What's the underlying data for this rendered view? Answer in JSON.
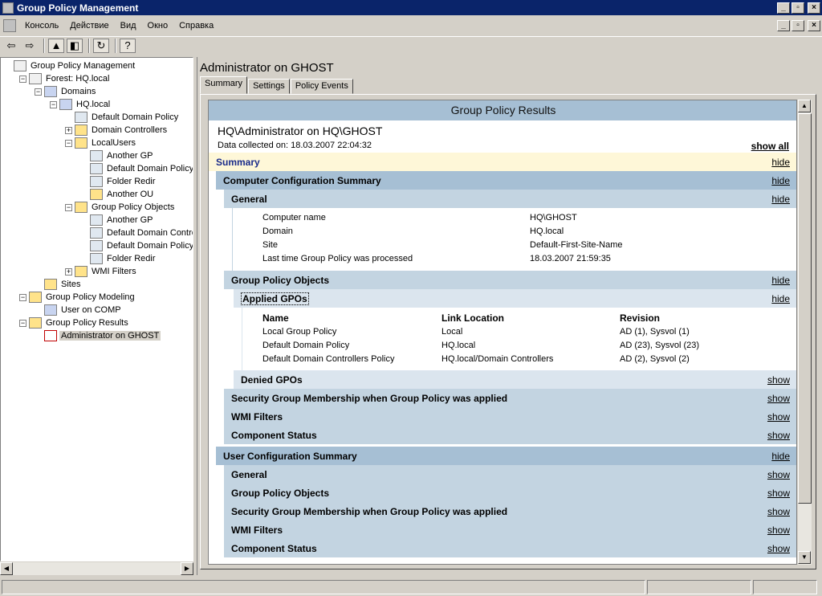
{
  "window": {
    "title": "Group Policy Management"
  },
  "menu": [
    "Консоль",
    "Действие",
    "Вид",
    "Окно",
    "Справка"
  ],
  "tree": [
    {
      "label": "Group Policy Management",
      "level": 0,
      "icon": "gpmc-icon",
      "expander": ""
    },
    {
      "label": "Forest: HQ.local",
      "level": 1,
      "icon": "forest-icon",
      "expander": "−"
    },
    {
      "label": "Domains",
      "level": 2,
      "icon": "domains-icon",
      "expander": "−"
    },
    {
      "label": "HQ.local",
      "level": 3,
      "icon": "domain-icon",
      "expander": "−"
    },
    {
      "label": "Default Domain Policy",
      "level": 4,
      "icon": "gpo-link-icon",
      "expander": ""
    },
    {
      "label": "Domain Controllers",
      "level": 4,
      "icon": "ou-icon",
      "expander": "+"
    },
    {
      "label": "LocalUsers",
      "level": 4,
      "icon": "ou-icon",
      "expander": "−"
    },
    {
      "label": "Another GP",
      "level": 5,
      "icon": "gpo-link-icon",
      "expander": ""
    },
    {
      "label": "Default Domain Policy",
      "level": 5,
      "icon": "gpo-link-icon",
      "expander": ""
    },
    {
      "label": "Folder Redir",
      "level": 5,
      "icon": "gpo-link-icon",
      "expander": ""
    },
    {
      "label": "Another OU",
      "level": 5,
      "icon": "ou-icon",
      "expander": ""
    },
    {
      "label": "Group Policy Objects",
      "level": 4,
      "icon": "gpo-folder-icon",
      "expander": "−"
    },
    {
      "label": "Another GP",
      "level": 5,
      "icon": "gpo-icon",
      "expander": ""
    },
    {
      "label": "Default Domain Controller",
      "level": 5,
      "icon": "gpo-icon",
      "expander": ""
    },
    {
      "label": "Default Domain Policy",
      "level": 5,
      "icon": "gpo-icon",
      "expander": ""
    },
    {
      "label": "Folder Redir",
      "level": 5,
      "icon": "gpo-icon",
      "expander": ""
    },
    {
      "label": "WMI Filters",
      "level": 4,
      "icon": "wmi-folder-icon",
      "expander": "+"
    },
    {
      "label": "Sites",
      "level": 2,
      "icon": "sites-icon",
      "expander": ""
    },
    {
      "label": "Group Policy Modeling",
      "level": 1,
      "icon": "modeling-icon",
      "expander": "−"
    },
    {
      "label": "User on COMP",
      "level": 2,
      "icon": "modeling-result-icon",
      "expander": ""
    },
    {
      "label": "Group Policy Results",
      "level": 1,
      "icon": "results-icon",
      "expander": "−"
    },
    {
      "label": "Administrator on GHOST",
      "level": 2,
      "icon": "result-report-icon",
      "expander": "",
      "selected": true
    }
  ],
  "main": {
    "title": "Administrator on GHOST",
    "tabs": [
      "Summary",
      "Settings",
      "Policy Events"
    ]
  },
  "report": {
    "header": "Group Policy Results",
    "subtitle": "HQ\\Administrator on HQ\\GHOST",
    "collected": "Data collected on: 18.03.2007 22:04:32",
    "show_all": "show all",
    "summary": {
      "label": "Summary",
      "action": "hide"
    },
    "computer": {
      "label": "Computer Configuration Summary",
      "action": "hide",
      "general": {
        "label": "General",
        "action": "hide",
        "rows": [
          {
            "k": "Computer name",
            "v": "HQ\\GHOST"
          },
          {
            "k": "Domain",
            "v": "HQ.local"
          },
          {
            "k": "Site",
            "v": "Default-First-Site-Name"
          },
          {
            "k": "Last time Group Policy was processed",
            "v": "18.03.2007 21:59:35"
          }
        ]
      },
      "gpo": {
        "label": "Group Policy Objects",
        "action": "hide",
        "applied": {
          "label": "Applied GPOs",
          "action": "hide",
          "columns": [
            "Name",
            "Link Location",
            "Revision"
          ],
          "rows": [
            [
              "Local Group Policy",
              "Local",
              "AD (1), Sysvol (1)"
            ],
            [
              "Default Domain Policy",
              "HQ.local",
              "AD (23), Sysvol (23)"
            ],
            [
              "Default Domain Controllers Policy",
              "HQ.local/Domain Controllers",
              "AD (2), Sysvol (2)"
            ]
          ]
        },
        "denied": {
          "label": "Denied GPOs",
          "action": "show"
        }
      },
      "security": {
        "label": "Security Group Membership when Group Policy was applied",
        "action": "show"
      },
      "wmi": {
        "label": "WMI Filters",
        "action": "show"
      },
      "component": {
        "label": "Component Status",
        "action": "show"
      }
    },
    "user": {
      "label": "User Configuration Summary",
      "action": "hide",
      "general": {
        "label": "General",
        "action": "show"
      },
      "gpo": {
        "label": "Group Policy Objects",
        "action": "show"
      },
      "security": {
        "label": "Security Group Membership when Group Policy was applied",
        "action": "show"
      },
      "wmi": {
        "label": "WMI Filters",
        "action": "show"
      },
      "component": {
        "label": "Component Status",
        "action": "show"
      }
    }
  }
}
